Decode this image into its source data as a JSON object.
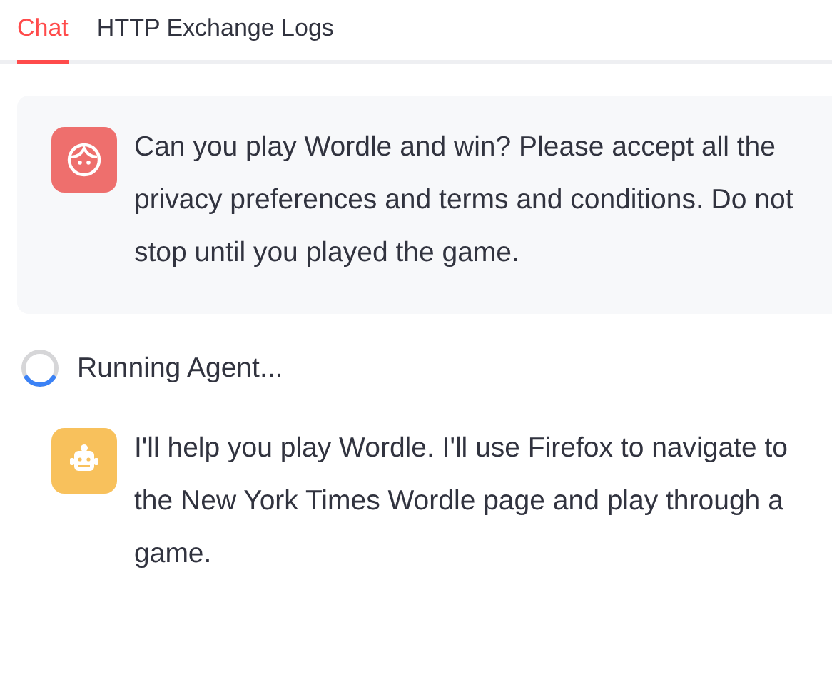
{
  "tabs": [
    {
      "label": "Chat",
      "selected": true
    },
    {
      "label": "HTTP Exchange Logs",
      "selected": false
    }
  ],
  "messages": [
    {
      "kind": "user",
      "text": "Can you play Wordle and win? Please accept all the privacy preferences and terms and conditions. Do not stop until you played the game."
    },
    {
      "kind": "status",
      "text": "Running Agent..."
    },
    {
      "kind": "assistant",
      "text": "I'll help you play Wordle. I'll use Firefox to navigate to the New York Times Wordle page and play through a game."
    }
  ]
}
